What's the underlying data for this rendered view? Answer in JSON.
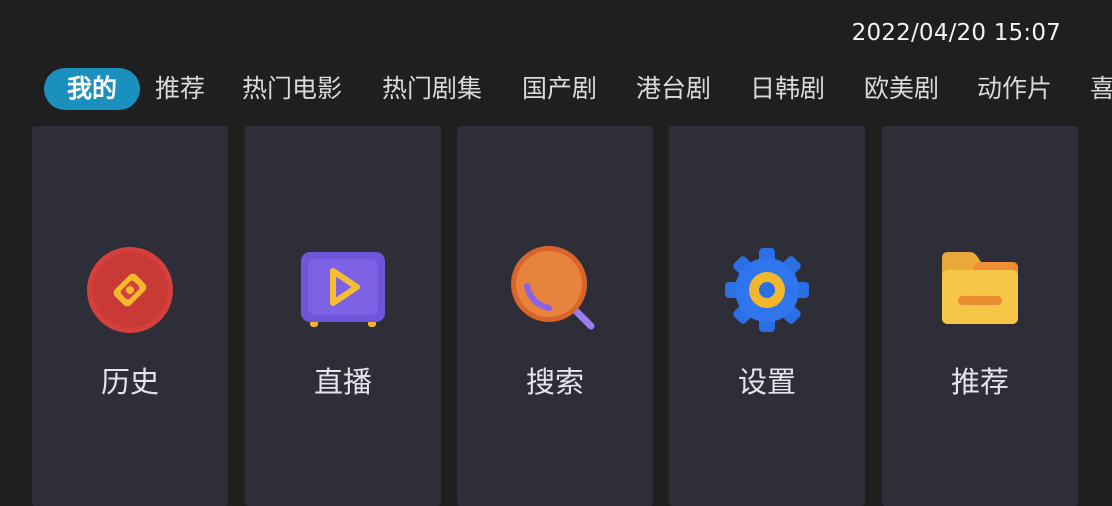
{
  "status_bar": {
    "datetime": "2022/04/20 15:07"
  },
  "tabs": [
    {
      "label": "我的",
      "active": true
    },
    {
      "label": "推荐"
    },
    {
      "label": "热门电影"
    },
    {
      "label": "热门剧集"
    },
    {
      "label": "国产剧"
    },
    {
      "label": "港台剧"
    },
    {
      "label": "日韩剧"
    },
    {
      "label": "欧美剧"
    },
    {
      "label": "动作片"
    },
    {
      "label": "喜"
    }
  ],
  "cards": [
    {
      "label": "历史",
      "icon": "compass-icon"
    },
    {
      "label": "直播",
      "icon": "tv-play-icon"
    },
    {
      "label": "搜索",
      "icon": "search-icon"
    },
    {
      "label": "设置",
      "icon": "gear-icon"
    },
    {
      "label": "推荐",
      "icon": "folder-icon"
    }
  ],
  "colors": {
    "background": "#1f1f1f",
    "card": "#2e2e38",
    "active_tab": "#1b8fbd"
  }
}
